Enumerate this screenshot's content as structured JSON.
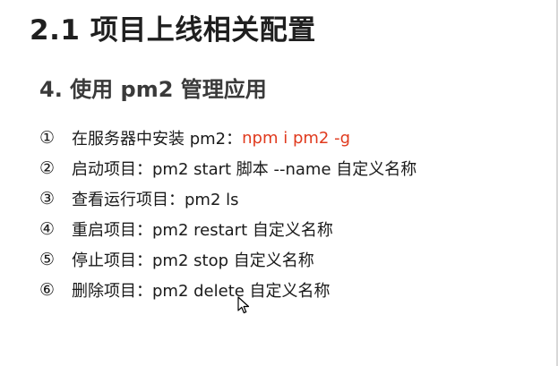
{
  "slide": {
    "title": "2.1 项目上线相关配置",
    "subtitle": "4. 使用 pm2 管理应用",
    "items": [
      {
        "num": "①",
        "text": "在服务器中安装 pm2：",
        "cmd": "npm i pm2 -g"
      },
      {
        "num": "②",
        "text": "启动项目：pm2 start 脚本 --name 自定义名称"
      },
      {
        "num": "③",
        "text": "查看运行项目：pm2 ls"
      },
      {
        "num": "④",
        "text": "重启项目：pm2 restart 自定义名称"
      },
      {
        "num": "⑤",
        "text": "停止项目：pm2 stop 自定义名称"
      },
      {
        "num": "⑥",
        "text": "删除项目：pm2 delete 自定义名称"
      }
    ]
  },
  "colors": {
    "accent_red": "#e03a1e",
    "text": "#1a1a1a"
  },
  "icons": {
    "cursor": "mouse-pointer-icon"
  }
}
